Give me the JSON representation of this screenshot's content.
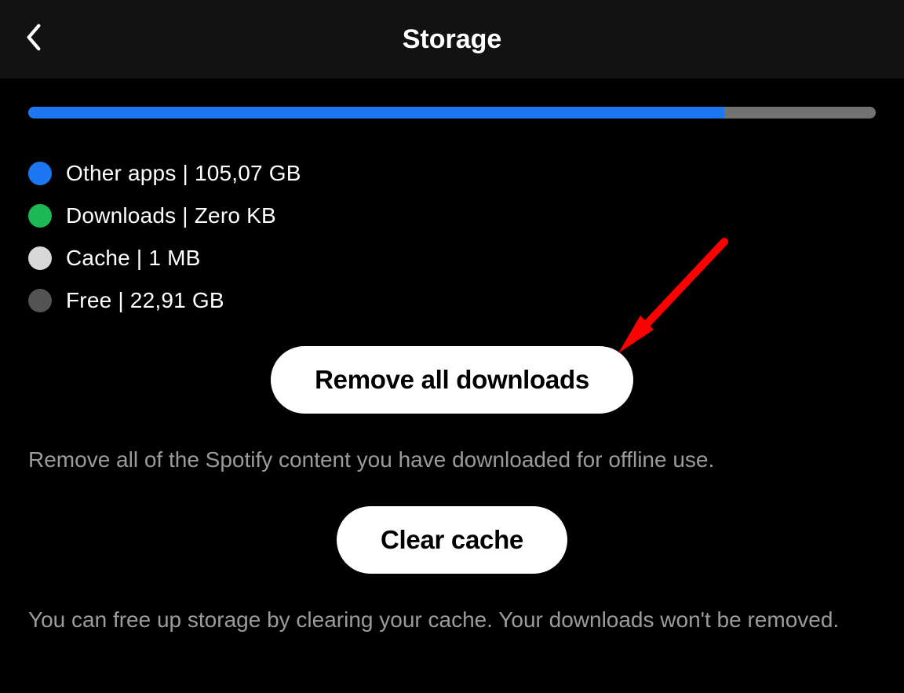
{
  "header": {
    "title": "Storage"
  },
  "storage": {
    "fill_percent": 82.1,
    "legend": [
      {
        "color": "#1e77f2",
        "label": "Other apps | 105,07 GB"
      },
      {
        "color": "#1cb955",
        "label": "Downloads | Zero KB"
      },
      {
        "color": "#d8d8d8",
        "label": "Cache | 1 MB"
      },
      {
        "color": "#535353",
        "label": "Free | 22,91 GB"
      }
    ]
  },
  "remove_downloads": {
    "button_label": "Remove all downloads",
    "description": "Remove all of the Spotify content you have downloaded for offline use."
  },
  "clear_cache": {
    "button_label": "Clear cache",
    "description": "You can free up storage by clearing your cache. Your downloads won't be removed."
  }
}
